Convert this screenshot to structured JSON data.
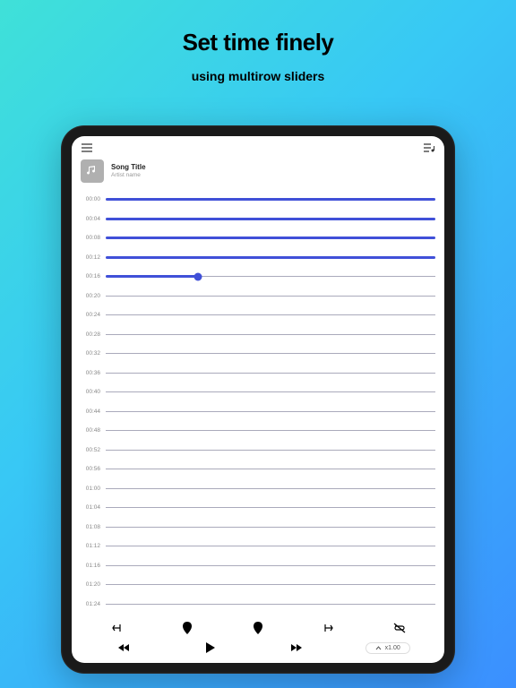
{
  "hero": {
    "title": "Set time finely",
    "subtitle": "using multirow sliders"
  },
  "song": {
    "title": "Song Title",
    "artist": "Artist name"
  },
  "rows": {
    "labels": [
      "00:00",
      "00:04",
      "00:08",
      "00:12",
      "00:16",
      "00:20",
      "00:24",
      "00:28",
      "00:32",
      "00:36",
      "00:40",
      "00:44",
      "00:48",
      "00:52",
      "00:56",
      "01:00",
      "01:04",
      "01:08",
      "01:12",
      "01:16",
      "01:20",
      "01:24"
    ],
    "full_rows": 4,
    "partial_fill_pct": 28
  },
  "playback": {
    "speed_label": "x1.00"
  },
  "colors": {
    "accent": "#4050d8"
  }
}
